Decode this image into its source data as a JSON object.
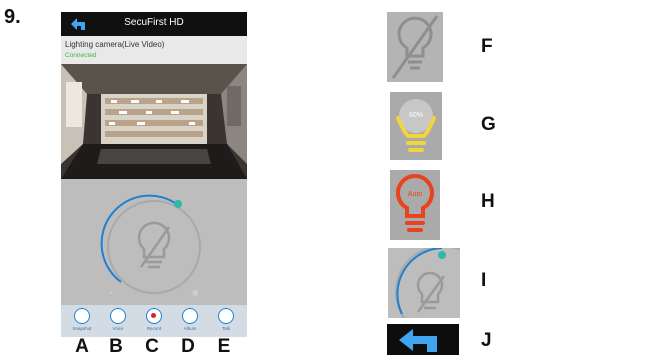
{
  "step_number": "9.",
  "app": {
    "title": "SecuFirst HD",
    "camera_name": "Lighting camera(Live Video)",
    "camera_status": "Connected"
  },
  "toolbar": [
    {
      "label": "Snapshot",
      "icon": "camera-icon"
    },
    {
      "label": "Voice",
      "icon": "speaker-icon"
    },
    {
      "label": "Record",
      "icon": "record-icon"
    },
    {
      "label": "Album",
      "icon": "album-icon"
    },
    {
      "label": "Talk",
      "icon": "microphone-icon"
    }
  ],
  "bottom_letters": [
    "A",
    "B",
    "C",
    "D",
    "E"
  ],
  "legend": [
    {
      "letter": "F",
      "icon": "bulb-off-icon"
    },
    {
      "letter": "G",
      "icon": "bulb-on-yellow-icon",
      "badge": "60%"
    },
    {
      "letter": "H",
      "icon": "bulb-auto-red-icon",
      "badge": "Auto"
    },
    {
      "letter": "I",
      "icon": "brightness-dial-icon"
    },
    {
      "letter": "J",
      "icon": "back-arrow-icon"
    }
  ],
  "colors": {
    "accent_blue": "#1f7fd2",
    "connected_green": "#3db43d",
    "bulb_yellow": "#f2d53a",
    "bulb_red": "#e8431f",
    "dial_teal": "#2fb8a8"
  }
}
